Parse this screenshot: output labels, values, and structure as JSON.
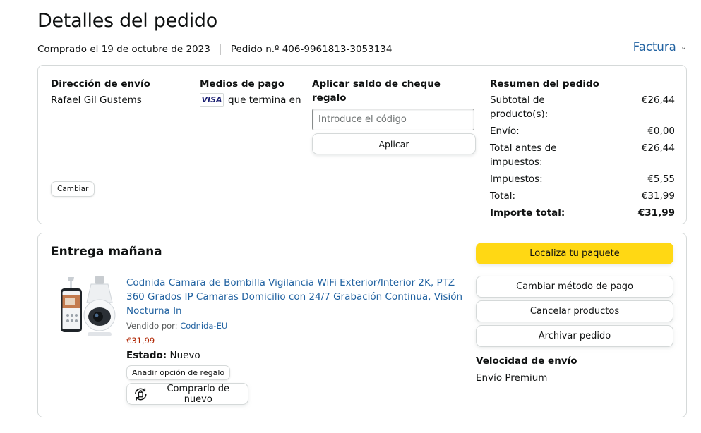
{
  "header": {
    "title": "Detalles del pedido",
    "purchased": "Comprado el 19 de octubre de 2023",
    "order_number": "Pedido n.º 406-9961813-3053134",
    "invoice_label": "Factura"
  },
  "shipping": {
    "heading": "Dirección de envío",
    "name": "Rafael Gil Gustems",
    "dot": ".",
    "change_label": "Cambiar"
  },
  "payment": {
    "heading": "Medios de pago",
    "card_brand": "VISA",
    "ending_text": "que termina en"
  },
  "gift_card": {
    "heading": "Aplicar saldo de cheque regalo",
    "placeholder": "Introduce el código",
    "apply_label": "Aplicar"
  },
  "summary": {
    "heading": "Resumen del pedido",
    "rows": [
      {
        "label": "Subtotal de producto(s):",
        "value": "€26,44"
      },
      {
        "label": "Envío:",
        "value": "€0,00"
      },
      {
        "label": "Total antes de impuestos:",
        "value": "€26,44"
      },
      {
        "label": "Impuestos:",
        "value": "€5,55"
      },
      {
        "label": "Total:",
        "value": "€31,99"
      },
      {
        "label": "Importe total:",
        "value": "€31,99"
      }
    ]
  },
  "delivery": {
    "title": "Entrega mañana",
    "product": {
      "title": "Codnida Camara de Bombilla Vigilancia WiFi Exterior/Interior 2K, PTZ 360 Grados IP Camaras Domicilio con 24/7 Grabación Continua, Visión Nocturna In",
      "seller_prefix": "Vendido por:",
      "seller": "Codnida-EU",
      "price": "€31,99",
      "status_label": "Estado:",
      "status_value": "Nuevo",
      "gift_option_label": "Añadir opción de regalo",
      "buy_again_label": "Comprarlo de nuevo"
    },
    "actions": {
      "track": "Localiza tu paquete",
      "change_payment": "Cambiar método de pago",
      "cancel": "Cancelar productos",
      "archive": "Archivar pedido"
    },
    "shipping_speed_label": "Velocidad de envío",
    "shipping_speed_value": "Envío Premium"
  },
  "colors": {
    "link": "#2162a1",
    "price": "#b12704",
    "primary_button": "#ffd814",
    "border": "#d5d9d9"
  }
}
